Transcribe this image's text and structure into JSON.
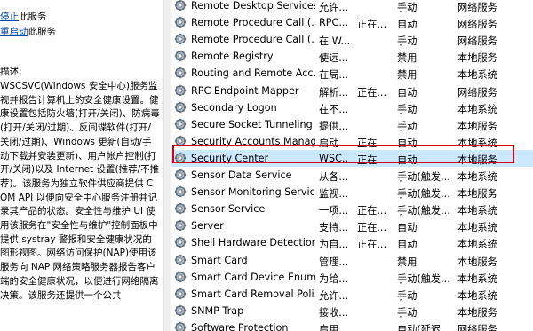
{
  "left_pane": {
    "stop_link": "停止",
    "stop_suffix": "此服务",
    "restart_link": "重启动",
    "restart_suffix": "此服务",
    "description_label": "描述:",
    "description_text": "WSCSVC(Windows 安全中心)服务监视并报告计算机上的安全健康设置。健康设置包括防火墙(打开/关闭)、防病毒(打开/关闭/过期)、反间谍软件(打开/关闭/过期)、Windows 更新(自动/手动下载并安装更新)、用户帐户控制(打开/关闭)以及 Internet 设置(推荐/不推荐)。该服务为独立软件供应商提供 COM API 以便向安全中心服务注册并记录其产品的状态。安全性与维护 UI 使用该服务在\"安全性与维护\"控制面板中提供 systray 警报和安全健康状况的图形视图。网络访问保护(NAP)使用该服务向 NAP 网络策略服务器报告客户端的安全健康状况，以便进行网络隔离决策。该服务还提供一个公共"
  },
  "services": [
    {
      "name": "Remote Desktop Services",
      "desc": "允许...",
      "status": "",
      "startup": "手动",
      "logon": "网络服务"
    },
    {
      "name": "Remote Procedure Call (...",
      "desc": "RPC...",
      "status": "正在...",
      "startup": "自动",
      "logon": "网络服务"
    },
    {
      "name": "Remote Procedure Call (...",
      "desc": "在 W...",
      "status": "",
      "startup": "手动",
      "logon": "网络服务"
    },
    {
      "name": "Remote Registry",
      "desc": "使远...",
      "status": "",
      "startup": "禁用",
      "logon": "本地服务"
    },
    {
      "name": "Routing and Remote Acc...",
      "desc": "在局...",
      "status": "",
      "startup": "禁用",
      "logon": "本地系统"
    },
    {
      "name": "RPC Endpoint Mapper",
      "desc": "解析...",
      "status": "正在...",
      "startup": "自动",
      "logon": "网络服务"
    },
    {
      "name": "Secondary Logon",
      "desc": "在不...",
      "status": "",
      "startup": "手动",
      "logon": "本地系统"
    },
    {
      "name": "Secure Socket Tunneling ...",
      "desc": "提供...",
      "status": "",
      "startup": "手动",
      "logon": "本地服务"
    },
    {
      "name": "Security Accounts Manag...",
      "desc": "启动...",
      "status": "正在...",
      "startup": "自动",
      "logon": "本地系统"
    },
    {
      "name": "Security Center",
      "desc": "WSC...",
      "status": "正在...",
      "startup": "自动",
      "logon": "本地服务",
      "selected": true
    },
    {
      "name": "Sensor Data Service",
      "desc": "从各...",
      "status": "",
      "startup": "手动(触发...",
      "logon": "本地系统"
    },
    {
      "name": "Sensor Monitoring Service",
      "desc": "监视...",
      "status": "",
      "startup": "手动(触发...",
      "logon": "本地服务"
    },
    {
      "name": "Sensor Service",
      "desc": "一项...",
      "status": "正在...",
      "startup": "手动(触发...",
      "logon": "本地系统"
    },
    {
      "name": "Server",
      "desc": "支持...",
      "status": "正在...",
      "startup": "自动",
      "logon": "本地系统"
    },
    {
      "name": "Shell Hardware Detection",
      "desc": "为自...",
      "status": "正在...",
      "startup": "自动",
      "logon": "本地系统"
    },
    {
      "name": "Smart Card",
      "desc": "管理...",
      "status": "",
      "startup": "禁用",
      "logon": "本地服务"
    },
    {
      "name": "Smart Card Device Enum...",
      "desc": "为给...",
      "status": "",
      "startup": "手动(触发...",
      "logon": "本地系统"
    },
    {
      "name": "Smart Card Removal Poli...",
      "desc": "允许...",
      "status": "",
      "startup": "手动",
      "logon": "本地系统"
    },
    {
      "name": "SNMP Trap",
      "desc": "接收...",
      "status": "",
      "startup": "手动",
      "logon": "本地服务"
    },
    {
      "name": "Software Protection",
      "desc": "启用...",
      "status": "",
      "startup": "自动(延迟...",
      "logon": "网络服务"
    }
  ],
  "icon_name": "service-gear-icon",
  "colors": {
    "selection_bg": "#cce8ff",
    "highlight_border": "#d9000d",
    "link": "#0645ad"
  }
}
